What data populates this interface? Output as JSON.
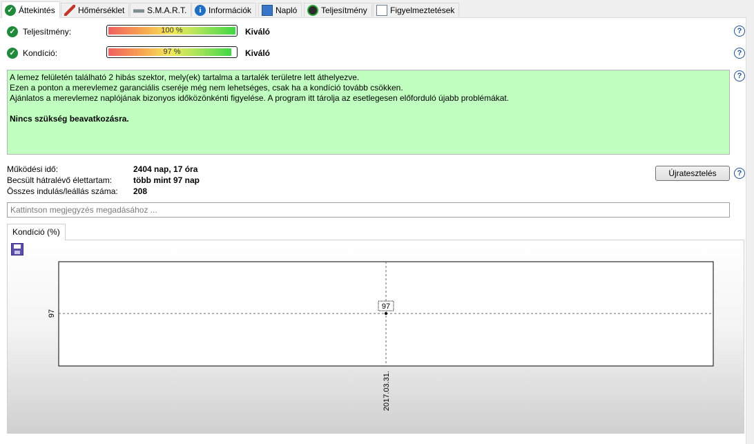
{
  "tabs": [
    {
      "label": "Áttekintés",
      "icon": "check-icon",
      "active": true
    },
    {
      "label": "Hőmérséklet",
      "icon": "thermometer-icon",
      "active": false
    },
    {
      "label": "S.M.A.R.T.",
      "icon": "disk-icon",
      "active": false
    },
    {
      "label": "Információk",
      "icon": "info-icon",
      "active": false
    },
    {
      "label": "Napló",
      "icon": "log-icon",
      "active": false
    },
    {
      "label": "Teljesítmény",
      "icon": "gauge-icon",
      "active": false
    },
    {
      "label": "Figyelmeztetések",
      "icon": "alerts-icon",
      "active": false
    }
  ],
  "performance": {
    "label": "Teljesítmény:",
    "value_text": "100 %",
    "value": 100,
    "rating": "Kiváló"
  },
  "condition": {
    "label": "Kondíció:",
    "value_text": "97 %",
    "value": 97,
    "rating": "Kiváló"
  },
  "message": {
    "lines": [
      "A lemez felületén található 2 hibás szektor, mely(ek) tartalma a tartalék területre lett áthelyezve.",
      "Ezen a ponton a merevlemez garanciális cseréje még nem lehetséges, csak ha a kondíció tovább csökken.",
      "Ajánlatos a merevlemez naplójának bizonyos időközönkénti figyelése. A program itt tárolja az esetlegesen előforduló újabb problémákat."
    ],
    "conclusion": "Nincs szükség beavatkozásra.",
    "background": "#c0ffc0"
  },
  "info": {
    "uptime_label": "Működési idő:",
    "uptime_value": "2404 nap, 17 óra",
    "remaining_label": "Becsült hátralévő élettartam:",
    "remaining_value": "több mint 97 nap",
    "starts_label": "Összes indulás/leállás száma:",
    "starts_value": "208"
  },
  "retest_button": "Újratesztelés",
  "note_placeholder": "Kattintson megjegyzés megadásához ...",
  "chart_tab": "Kondíció  (%)",
  "chart_data": {
    "type": "line",
    "x": [
      "2017.03.31."
    ],
    "series": [
      {
        "values": [
          97
        ]
      }
    ],
    "ytick_labels": [
      "97"
    ],
    "point_labels": [
      "97"
    ]
  }
}
